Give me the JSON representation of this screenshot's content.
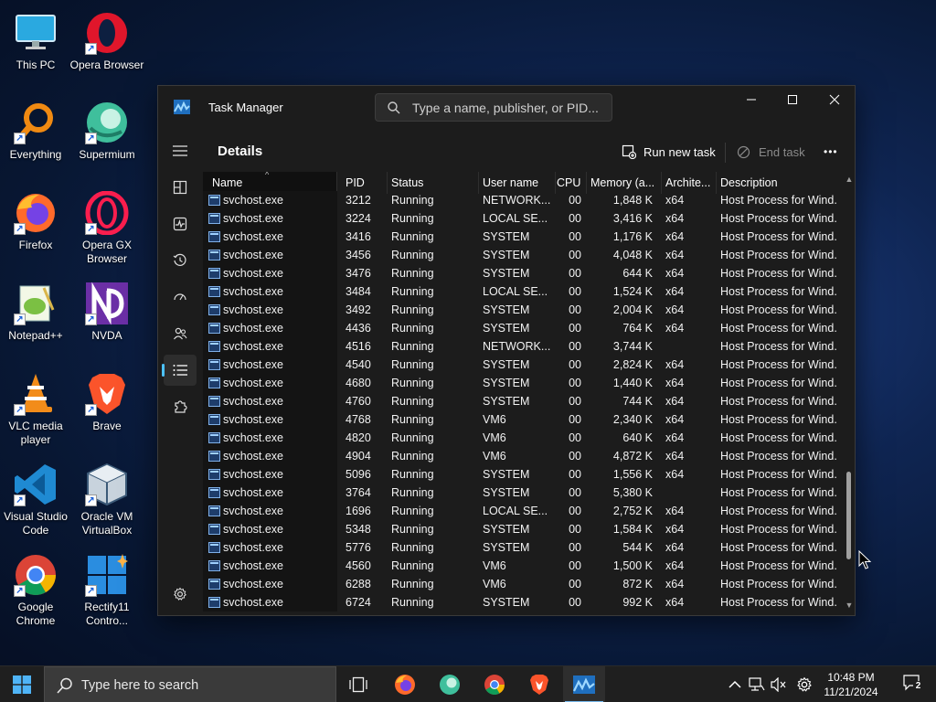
{
  "desktop": {
    "icons": [
      {
        "label": "This PC"
      },
      {
        "label": "Opera Browser"
      },
      {
        "label": "Everything"
      },
      {
        "label": "Supermium"
      },
      {
        "label": "Firefox"
      },
      {
        "label": "Opera GX Browser"
      },
      {
        "label": "Notepad++"
      },
      {
        "label": "NVDA"
      },
      {
        "label": "VLC media player"
      },
      {
        "label": "Brave"
      },
      {
        "label": "Visual Studio Code"
      },
      {
        "label": "Oracle VM VirtualBox"
      },
      {
        "label": "Google Chrome"
      },
      {
        "label": "Rectify11 Contro..."
      }
    ]
  },
  "task_manager": {
    "title": "Task Manager",
    "search_placeholder": "Type a name, publisher, or PID...",
    "page_heading": "Details",
    "run_new_task_label": "Run new task",
    "end_task_label": "End task",
    "more_label": "•••",
    "columns": [
      "Name",
      "PID",
      "Status",
      "User name",
      "CPU",
      "Memory (a...",
      "Archite...",
      "Description"
    ],
    "rows": [
      {
        "name": "svchost.exe",
        "pid": "3212",
        "status": "Running",
        "user": "NETWORK...",
        "cpu": "00",
        "mem": "1,848 K",
        "arch": "x64",
        "desc": "Host Process for Wind..."
      },
      {
        "name": "svchost.exe",
        "pid": "3224",
        "status": "Running",
        "user": "LOCAL SE...",
        "cpu": "00",
        "mem": "3,416 K",
        "arch": "x64",
        "desc": "Host Process for Wind..."
      },
      {
        "name": "svchost.exe",
        "pid": "3416",
        "status": "Running",
        "user": "SYSTEM",
        "cpu": "00",
        "mem": "1,176 K",
        "arch": "x64",
        "desc": "Host Process for Wind..."
      },
      {
        "name": "svchost.exe",
        "pid": "3456",
        "status": "Running",
        "user": "SYSTEM",
        "cpu": "00",
        "mem": "4,048 K",
        "arch": "x64",
        "desc": "Host Process for Wind..."
      },
      {
        "name": "svchost.exe",
        "pid": "3476",
        "status": "Running",
        "user": "SYSTEM",
        "cpu": "00",
        "mem": "644 K",
        "arch": "x64",
        "desc": "Host Process for Wind..."
      },
      {
        "name": "svchost.exe",
        "pid": "3484",
        "status": "Running",
        "user": "LOCAL SE...",
        "cpu": "00",
        "mem": "1,524 K",
        "arch": "x64",
        "desc": "Host Process for Wind..."
      },
      {
        "name": "svchost.exe",
        "pid": "3492",
        "status": "Running",
        "user": "SYSTEM",
        "cpu": "00",
        "mem": "2,004 K",
        "arch": "x64",
        "desc": "Host Process for Wind..."
      },
      {
        "name": "svchost.exe",
        "pid": "4436",
        "status": "Running",
        "user": "SYSTEM",
        "cpu": "00",
        "mem": "764 K",
        "arch": "x64",
        "desc": "Host Process for Wind..."
      },
      {
        "name": "svchost.exe",
        "pid": "4516",
        "status": "Running",
        "user": "NETWORK...",
        "cpu": "00",
        "mem": "3,744 K",
        "arch": "",
        "desc": "Host Process for Wind..."
      },
      {
        "name": "svchost.exe",
        "pid": "4540",
        "status": "Running",
        "user": "SYSTEM",
        "cpu": "00",
        "mem": "2,824 K",
        "arch": "x64",
        "desc": "Host Process for Wind..."
      },
      {
        "name": "svchost.exe",
        "pid": "4680",
        "status": "Running",
        "user": "SYSTEM",
        "cpu": "00",
        "mem": "1,440 K",
        "arch": "x64",
        "desc": "Host Process for Wind..."
      },
      {
        "name": "svchost.exe",
        "pid": "4760",
        "status": "Running",
        "user": "SYSTEM",
        "cpu": "00",
        "mem": "744 K",
        "arch": "x64",
        "desc": "Host Process for Wind..."
      },
      {
        "name": "svchost.exe",
        "pid": "4768",
        "status": "Running",
        "user": "VM6",
        "cpu": "00",
        "mem": "2,340 K",
        "arch": "x64",
        "desc": "Host Process for Wind..."
      },
      {
        "name": "svchost.exe",
        "pid": "4820",
        "status": "Running",
        "user": "VM6",
        "cpu": "00",
        "mem": "640 K",
        "arch": "x64",
        "desc": "Host Process for Wind..."
      },
      {
        "name": "svchost.exe",
        "pid": "4904",
        "status": "Running",
        "user": "VM6",
        "cpu": "00",
        "mem": "4,872 K",
        "arch": "x64",
        "desc": "Host Process for Wind..."
      },
      {
        "name": "svchost.exe",
        "pid": "5096",
        "status": "Running",
        "user": "SYSTEM",
        "cpu": "00",
        "mem": "1,556 K",
        "arch": "x64",
        "desc": "Host Process for Wind..."
      },
      {
        "name": "svchost.exe",
        "pid": "3764",
        "status": "Running",
        "user": "SYSTEM",
        "cpu": "00",
        "mem": "5,380 K",
        "arch": "",
        "desc": "Host Process for Wind..."
      },
      {
        "name": "svchost.exe",
        "pid": "1696",
        "status": "Running",
        "user": "LOCAL SE...",
        "cpu": "00",
        "mem": "2,752 K",
        "arch": "x64",
        "desc": "Host Process for Wind..."
      },
      {
        "name": "svchost.exe",
        "pid": "5348",
        "status": "Running",
        "user": "SYSTEM",
        "cpu": "00",
        "mem": "1,584 K",
        "arch": "x64",
        "desc": "Host Process for Wind..."
      },
      {
        "name": "svchost.exe",
        "pid": "5776",
        "status": "Running",
        "user": "SYSTEM",
        "cpu": "00",
        "mem": "544 K",
        "arch": "x64",
        "desc": "Host Process for Wind..."
      },
      {
        "name": "svchost.exe",
        "pid": "4560",
        "status": "Running",
        "user": "VM6",
        "cpu": "00",
        "mem": "1,500 K",
        "arch": "x64",
        "desc": "Host Process for Wind..."
      },
      {
        "name": "svchost.exe",
        "pid": "6288",
        "status": "Running",
        "user": "VM6",
        "cpu": "00",
        "mem": "872 K",
        "arch": "x64",
        "desc": "Host Process for Wind..."
      },
      {
        "name": "svchost.exe",
        "pid": "6724",
        "status": "Running",
        "user": "SYSTEM",
        "cpu": "00",
        "mem": "992 K",
        "arch": "x64",
        "desc": "Host Process for Wind..."
      }
    ]
  },
  "taskbar": {
    "search_text": "Type here to search",
    "time": "10:48 PM",
    "date": "11/21/2024",
    "notification_count": "2"
  },
  "colors": {
    "accent": "#4cc2ff",
    "window_bg": "#1c1c1c",
    "taskbar_bg": "#1f1f1f"
  }
}
